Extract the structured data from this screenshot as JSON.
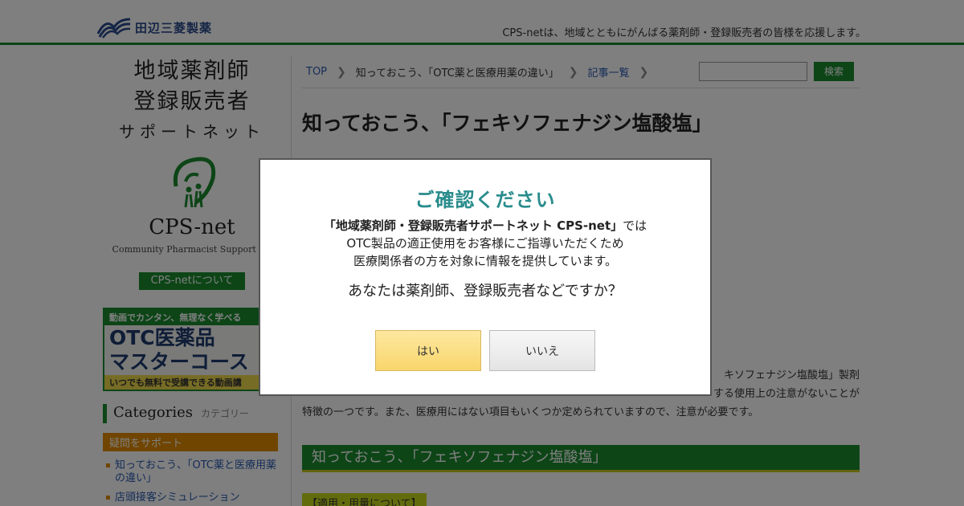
{
  "header": {
    "brand": "田辺三菱製薬",
    "tagline": "CPS-netは、地域とともにがんばる薬剤師・登録販売者の皆様を応援します。"
  },
  "sidebar": {
    "title_line1": "地域薬剤師",
    "title_line2": "登録販売者",
    "title_line3": "サポートネット",
    "logo_word": "CPS-net",
    "logo_sub": "Community Pharmacist Support Ne",
    "about_label": "CPS-netについて",
    "banner_line1": "動画でカンタン、無理なく学べる",
    "banner_line2": "OTC医薬品",
    "banner_line3": "マスターコース",
    "banner_line4": "いつでも無料で受講できる動画講",
    "categories_en": "Categories",
    "categories_ja": "カテゴリー",
    "section_label": "疑問をサポート",
    "items": [
      {
        "label": "知っておこう、「OTC薬と医療用薬の違い」"
      },
      {
        "label": "店頭接客シミュレーション"
      }
    ]
  },
  "breadcrumb": {
    "items": [
      {
        "label": "TOP"
      },
      {
        "label": "知っておこう、「OTC薬と医療用薬の違い」"
      },
      {
        "label": "記事一覧"
      }
    ]
  },
  "search": {
    "placeholder": "",
    "button_label": "検索"
  },
  "main": {
    "title": "知っておこう、「フェキソフェナジン塩酸塩」",
    "body_line1": "キソフェナジン塩酸塩」製剤",
    "body_line2": "する使用上の注意がないことが",
    "body_line3": "特徴の一つです。また、医療用にはない項目もいくつか定められていますので、注意が必要です。",
    "section_title": "知っておこう、「フェキソフェナジン塩酸塩」",
    "subhead": "【適用・用量について】"
  },
  "modal": {
    "title": "ご確認ください",
    "line1_strong": "「地域薬剤師・登録販売者サポートネット CPS-net」",
    "line1_rest": "では",
    "line2": "OTC製品の適正使用をお客様にご指導いただくため",
    "line3": "医療関係者の方を対象に情報を提供しています。",
    "question": "あなたは薬剤師、登録販売者などですか？",
    "yes_label": "はい",
    "no_label": "いいえ"
  },
  "colors": {
    "brand_green": "#1a8a2e",
    "modal_title": "#2a8c8c",
    "category_orange": "#e08a00",
    "link_blue": "#2a5ab0"
  }
}
